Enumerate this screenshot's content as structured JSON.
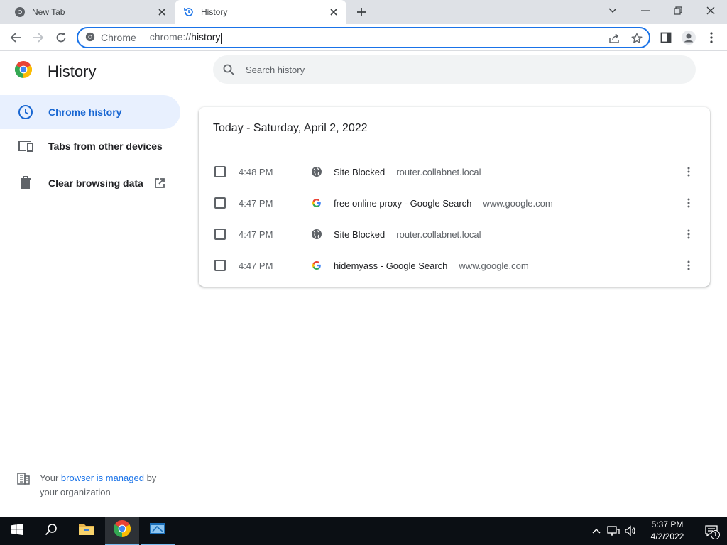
{
  "tabs": [
    {
      "title": "New Tab",
      "active": false,
      "icon": "chrome-icon"
    },
    {
      "title": "History",
      "active": true,
      "icon": "history-icon"
    }
  ],
  "omnibox": {
    "chip_label": "Chrome",
    "url_scheme": "chrome://",
    "url_host": "history"
  },
  "sidebar": {
    "title": "History",
    "items": [
      {
        "label": "Chrome history",
        "icon": "clock-icon",
        "selected": true
      },
      {
        "label": "Tabs from other devices",
        "icon": "devices-icon",
        "selected": false
      },
      {
        "label": "Clear browsing data",
        "icon": "trash-icon",
        "selected": false
      }
    ],
    "managed": {
      "prefix": "Your ",
      "link": "browser is managed",
      "suffix": " by",
      "line2": "your organization"
    }
  },
  "search": {
    "placeholder": "Search history"
  },
  "history": {
    "date_header": "Today - Saturday, April 2, 2022",
    "rows": [
      {
        "time": "4:48 PM",
        "favicon": "globe-icon",
        "title": "Site Blocked",
        "domain": "router.collabnet.local"
      },
      {
        "time": "4:47 PM",
        "favicon": "google-icon",
        "title": "free online proxy - Google Search",
        "domain": "www.google.com"
      },
      {
        "time": "4:47 PM",
        "favicon": "globe-icon",
        "title": "Site Blocked",
        "domain": "router.collabnet.local"
      },
      {
        "time": "4:47 PM",
        "favicon": "google-icon",
        "title": "hidemyass - Google Search",
        "domain": "www.google.com"
      }
    ]
  },
  "taskbar": {
    "time": "5:37 PM",
    "date": "4/2/2022",
    "notification_count": "1"
  },
  "colors": {
    "accent": "#1a73e8",
    "selected_bg": "#e8f0fe",
    "tabstrip": "#dee1e6",
    "taskbar": "#0b0f14"
  }
}
